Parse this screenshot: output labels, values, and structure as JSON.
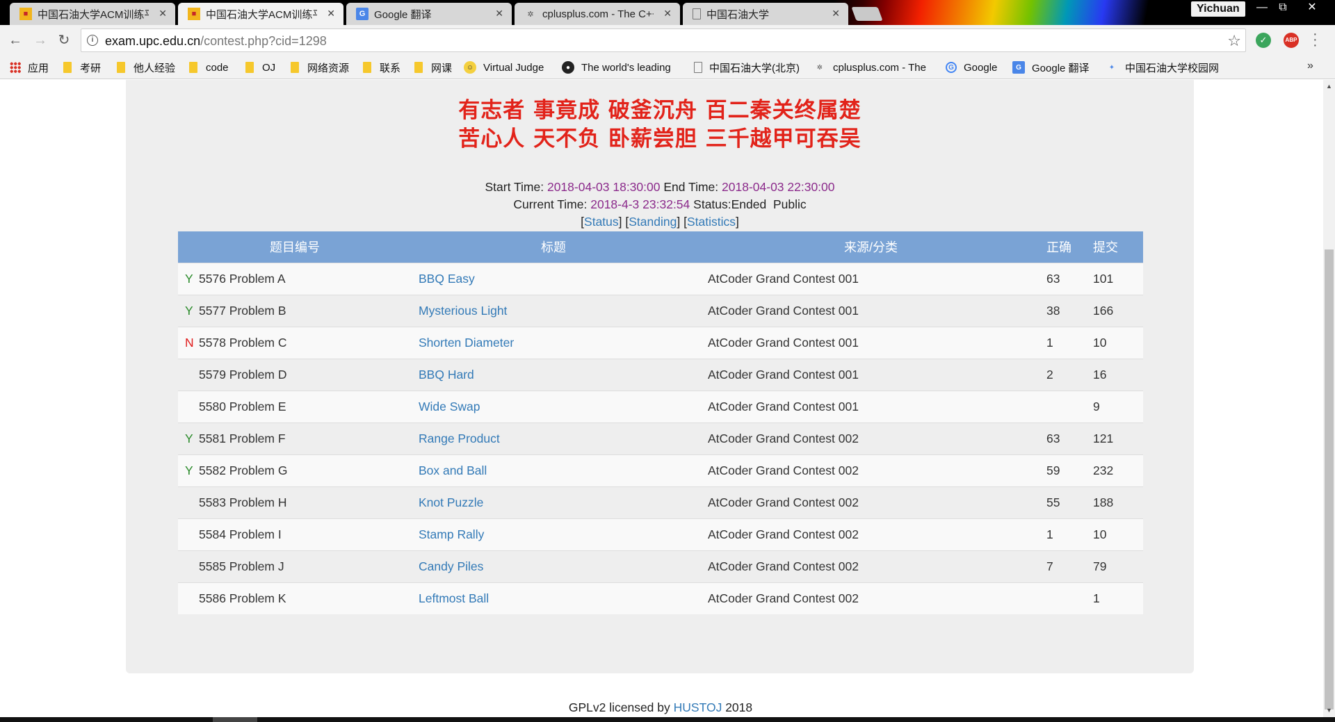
{
  "browser": {
    "tabs": [
      {
        "label": "中国石油大学ACM训练平台",
        "icon": "contest-favicon",
        "active": false
      },
      {
        "label": "中国石油大学ACM训练平台",
        "icon": "contest-favicon",
        "active": true
      },
      {
        "label": "Google 翻译",
        "icon": "google-translate-favicon",
        "active": false
      },
      {
        "label": "cplusplus.com - The C++ Resources Network",
        "icon": "cplusplus-favicon",
        "active": false
      },
      {
        "label": "中国石油大学",
        "icon": "page-favicon",
        "active": false
      }
    ],
    "profile_name": "Yichuan",
    "window_controls": {
      "minimize": "—",
      "restore": "⧉",
      "close": "✕"
    },
    "url_host": "exam.upc.edu.cn",
    "url_path": "/contest.php?cid=1298",
    "extensions": [
      {
        "name": "shield-extension",
        "color": "#3ba55c",
        "text": "✓"
      },
      {
        "name": "adblock-plus",
        "color": "#d93025",
        "text": "ABP"
      }
    ],
    "bookmarks": [
      {
        "label": "应用",
        "type": "apps"
      },
      {
        "label": "考研",
        "type": "folder"
      },
      {
        "label": "他人经验",
        "type": "folder"
      },
      {
        "label": "code",
        "type": "folder"
      },
      {
        "label": "OJ",
        "type": "folder"
      },
      {
        "label": "网络资源",
        "type": "folder"
      },
      {
        "label": "联系",
        "type": "folder"
      },
      {
        "label": "网课",
        "type": "folder"
      },
      {
        "label": "Virtual Judge",
        "type": "site"
      },
      {
        "label": "The world's leading",
        "type": "site"
      },
      {
        "label": "中国石油大学(北京)",
        "type": "site"
      },
      {
        "label": "cplusplus.com - The",
        "type": "site"
      },
      {
        "label": "Google",
        "type": "site"
      },
      {
        "label": "Google 翻译",
        "type": "site"
      },
      {
        "label": "中国石油大学校园网",
        "type": "site"
      }
    ],
    "bookmarks_overflow": "»"
  },
  "page": {
    "motto_line1": "有志者 事竟成 破釜沉舟 百二秦关终属楚",
    "motto_line2": "苦心人 天不负 卧薪尝胆 三千越甲可吞吴",
    "start_label": "Start Time:",
    "start_time": "2018-04-03 18:30:00",
    "end_label": "End Time:",
    "end_time": "2018-04-03 22:30:00",
    "current_label": "Current Time:",
    "current_time": "2018-4-3 23:32:54",
    "status_text": "Status:Ended",
    "visibility": "Public",
    "links": {
      "status": "Status",
      "standing": "Standing",
      "statistics": "Statistics"
    },
    "table": {
      "headers": {
        "id": "题目编号",
        "title": "标题",
        "source": "来源/分类",
        "accepted": "正确",
        "submitted": "提交"
      },
      "rows": [
        {
          "mark": "Y",
          "id": "5576 Problem  A",
          "title": "BBQ Easy",
          "source": "AtCoder Grand Contest 001",
          "accepted": "63",
          "submitted": "101"
        },
        {
          "mark": "Y",
          "id": "5577 Problem  B",
          "title": "Mysterious Light",
          "source": "AtCoder Grand Contest 001",
          "accepted": "38",
          "submitted": "166"
        },
        {
          "mark": "N",
          "id": "5578 Problem  C",
          "title": "Shorten Diameter",
          "source": "AtCoder Grand Contest 001",
          "accepted": "1",
          "submitted": "10"
        },
        {
          "mark": "",
          "id": "5579 Problem  D",
          "title": "BBQ Hard",
          "source": "AtCoder Grand Contest 001",
          "accepted": "2",
          "submitted": "16"
        },
        {
          "mark": "",
          "id": "5580 Problem  E",
          "title": "Wide Swap",
          "source": "AtCoder Grand Contest 001",
          "accepted": "",
          "submitted": "9"
        },
        {
          "mark": "Y",
          "id": "5581 Problem  F",
          "title": "Range Product",
          "source": "AtCoder Grand Contest 002",
          "accepted": "63",
          "submitted": "121"
        },
        {
          "mark": "Y",
          "id": "5582 Problem  G",
          "title": "Box and Ball",
          "source": "AtCoder Grand Contest 002",
          "accepted": "59",
          "submitted": "232"
        },
        {
          "mark": "",
          "id": "5583 Problem  H",
          "title": "Knot Puzzle",
          "source": "AtCoder Grand Contest 002",
          "accepted": "55",
          "submitted": "188"
        },
        {
          "mark": "",
          "id": "5584 Problem  I",
          "title": "Stamp Rally",
          "source": "AtCoder Grand Contest 002",
          "accepted": "1",
          "submitted": "10"
        },
        {
          "mark": "",
          "id": "5585 Problem  J",
          "title": "Candy Piles",
          "source": "AtCoder Grand Contest 002",
          "accepted": "7",
          "submitted": "79"
        },
        {
          "mark": "",
          "id": "5586 Problem  K",
          "title": "Leftmost Ball",
          "source": "AtCoder Grand Contest 002",
          "accepted": "",
          "submitted": "1"
        }
      ]
    },
    "footer_prefix": "GPLv2 licensed by",
    "footer_link": "HUSTOJ",
    "footer_year": "2018"
  }
}
